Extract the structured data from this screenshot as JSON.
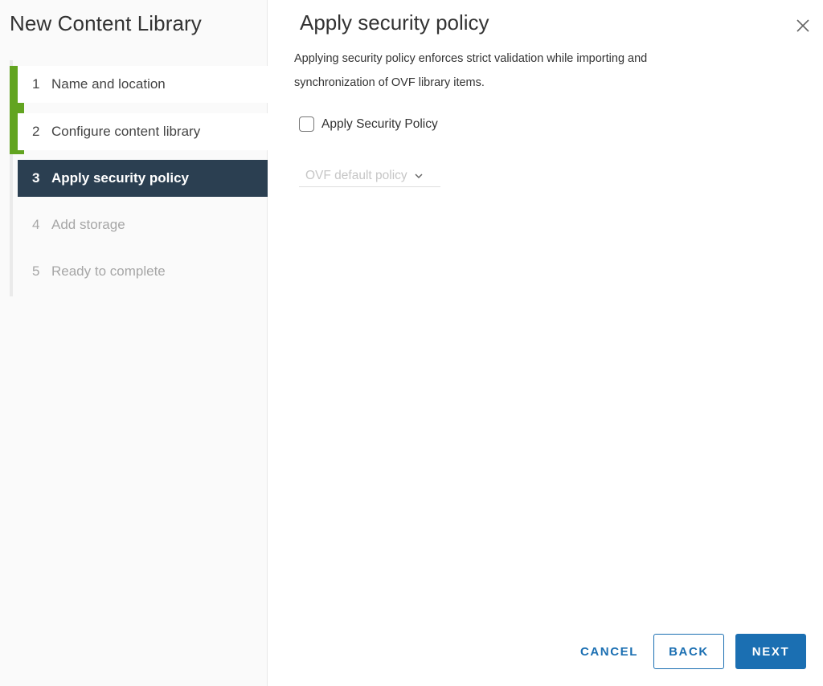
{
  "sidebar": {
    "title": "New Content Library",
    "steps": [
      {
        "num": "1",
        "label": "Name and location"
      },
      {
        "num": "2",
        "label": "Configure content library"
      },
      {
        "num": "3",
        "label": "Apply security policy"
      },
      {
        "num": "4",
        "label": "Add storage"
      },
      {
        "num": "5",
        "label": "Ready to complete"
      }
    ]
  },
  "main": {
    "title": "Apply security policy",
    "description_line1": "Applying security policy enforces strict validation while importing and",
    "description_line2": "synchronization of OVF library items.",
    "checkbox_label": "Apply Security Policy",
    "checkbox_checked": false,
    "policy_select": {
      "selected": "OVF default policy",
      "disabled": true
    }
  },
  "footer": {
    "cancel_label": "CANCEL",
    "back_label": "BACK",
    "next_label": "NEXT"
  },
  "icons": {
    "close": "close-icon",
    "dropdown": "chevron-down-icon"
  },
  "colors": {
    "accent": "#1b6fb2",
    "active_step_bg": "#2b3f51",
    "completed_step_bar": "#62a420"
  }
}
